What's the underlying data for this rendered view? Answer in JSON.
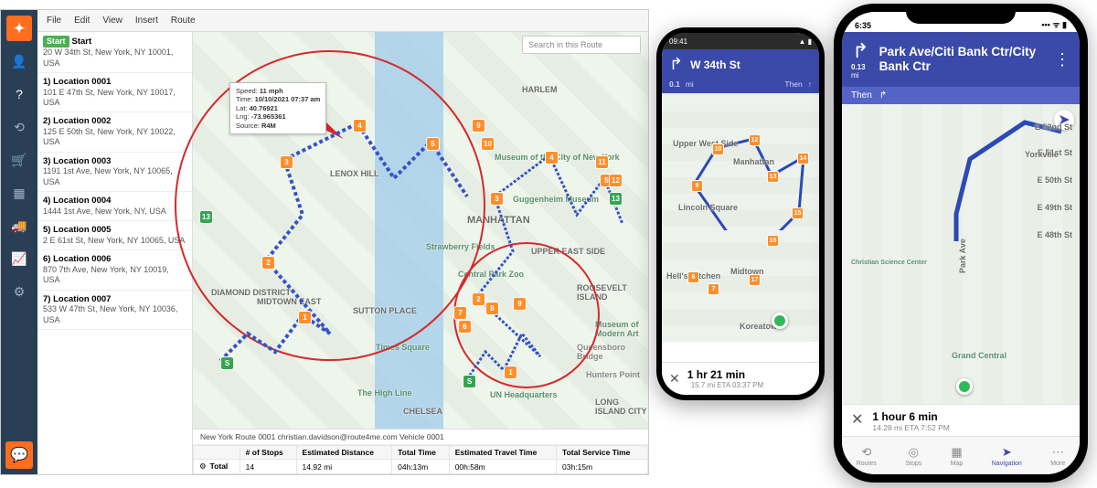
{
  "desktop": {
    "menu": [
      "File",
      "Edit",
      "View",
      "Insert",
      "Route"
    ],
    "search_placeholder": "Search in this Route",
    "start_badge": "Start",
    "start_label": "Start",
    "start_addr": "20 W 34th St, New York, NY 10001, USA",
    "stops": [
      {
        "label": "1) Location 0001",
        "addr": "101 E 47th St, New York, NY 10017, USA"
      },
      {
        "label": "2) Location 0002",
        "addr": "125 E 50th St, New York, NY 10022, USA"
      },
      {
        "label": "3) Location 0003",
        "addr": "1191 1st Ave, New York, NY 10065, USA"
      },
      {
        "label": "4) Location 0004",
        "addr": "1444 1st Ave, New York, NY, USA"
      },
      {
        "label": "5) Location 0005",
        "addr": "2 E 61st St, New York, NY 10065, USA"
      },
      {
        "label": "6) Location 0006",
        "addr": "870 7th Ave, New York, NY 10019, USA"
      },
      {
        "label": "7) Location 0007",
        "addr": "533 W 47th St, New York, NY 10036, USA"
      }
    ],
    "tooltip": {
      "speed_label": "Speed:",
      "speed": "11 mph",
      "time_label": "Time:",
      "time": "10/10/2021 07:37 am",
      "lat_label": "Lat:",
      "lat": "40.76921",
      "lng_label": "Lng:",
      "lng": "-73.965361",
      "source_label": "Source:",
      "source": "R4M"
    },
    "map_labels": {
      "manhattan": "MANHATTAN",
      "harlem": "HARLEM",
      "lenox": "LENOX HILL",
      "midtown": "MIDTOWN EAST",
      "uppereast": "UPPER EAST SIDE",
      "chelsea": "CHELSEA",
      "diamond": "DIAMOND DISTRICT",
      "sutton": "SUTTON PLACE",
      "roosevelt": "ROOSEVELT ISLAND",
      "longisland": "LONG ISLAND CITY",
      "guggenheim": "Guggenheim Museum",
      "met": "Museum of the City of New York",
      "momath": "Museum of Modern Art",
      "centralpark": "Central Park Zoo",
      "strawberry": "Strawberry Fields",
      "timessq": "Times Square",
      "highline": "The High Line",
      "unhq": "UN Headquarters",
      "queensboro": "Queensboro Bridge",
      "hunters": "Hunters Point"
    },
    "info_title": "New York Route 0001 christian.davidson@route4me.com Vehicle 0001",
    "table": {
      "headers": [
        "",
        "# of Stops",
        "Estimated Distance",
        "Total Time",
        "Estimated Travel Time",
        "Total Service Time"
      ],
      "row_label": "Total",
      "values": [
        "14",
        "14.92 mi",
        "04h:13m",
        "00h:58m",
        "03h:15m"
      ]
    }
  },
  "android": {
    "time": "09:41",
    "street": "W 34th St",
    "distance": "0.1",
    "distance_unit": "mi",
    "then_label": "Then",
    "labels": {
      "upperwest": "Upper West Side",
      "lincoln": "Lincoln Square",
      "midtown": "Midtown",
      "koreatown": "Koreatown",
      "hellskitchen": "Hell's Kitchen",
      "manhattan": "Manhattan"
    },
    "eta_time": "1 hr 21 min",
    "eta_sub": "15.7 mi   ETA 03:37 PM"
  },
  "iphone": {
    "time": "6:35",
    "street": "Park Ave/Citi Bank Ctr/City Bank Ctr",
    "distance": "0.13",
    "distance_unit": "mi",
    "then_label": "Then",
    "labels": {
      "e52": "E 52nd St",
      "e51": "E 51st St",
      "e50": "E 50th St",
      "e49": "E 49th St",
      "e48": "E 48th St",
      "parkave": "Park Ave",
      "grandcentral": "Grand Central",
      "christian": "Christian Science Center",
      "yorkville": "Yorkville"
    },
    "eta_time": "1 hour 6 min",
    "eta_sub": "14.28 mi   ETA 7:52 PM",
    "tabs": [
      "Routes",
      "Stops",
      "Map",
      "Navigation",
      "More"
    ],
    "active_tab": 3
  }
}
